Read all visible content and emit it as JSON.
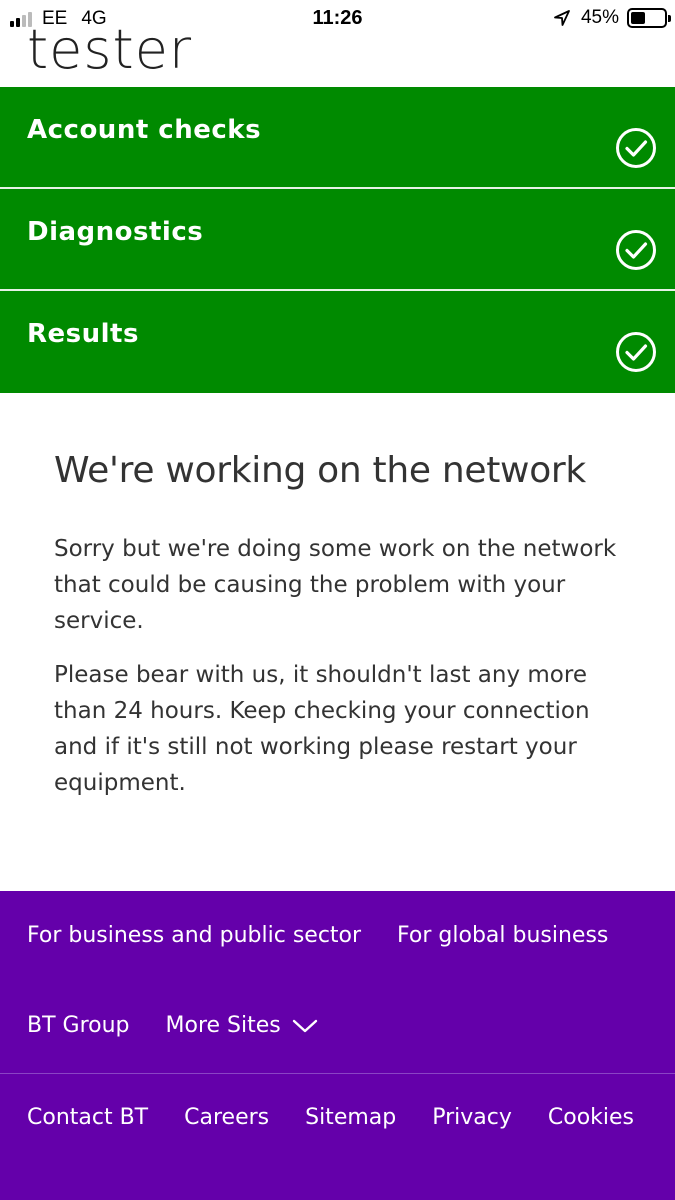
{
  "status_bar": {
    "carrier": "EE",
    "network": "4G",
    "time": "11:26",
    "battery": "45%",
    "battery_level": 0.45
  },
  "app": {
    "title": "tester"
  },
  "steps": [
    {
      "label": "Account checks",
      "status": "complete"
    },
    {
      "label": "Diagnostics",
      "status": "complete"
    },
    {
      "label": "Results",
      "status": "complete"
    }
  ],
  "main": {
    "heading": "We're working on the network",
    "paragraph1": "Sorry but we're doing some work on the network that could be causing the problem with your service.",
    "paragraph2": "Please bear with us, it shouldn't last any more than 24 hours. Keep checking your connection and if it's still not working please restart your equipment."
  },
  "footer": {
    "business_link": "For business and public sector",
    "global_link": "For global business",
    "group_link": "BT Group",
    "more_sites": "More Sites",
    "links": [
      "Contact BT",
      "Careers",
      "Sitemap",
      "Privacy",
      "Cookies"
    ]
  },
  "colors": {
    "step_green": "#008a00",
    "footer_purple": "#6400aa"
  }
}
